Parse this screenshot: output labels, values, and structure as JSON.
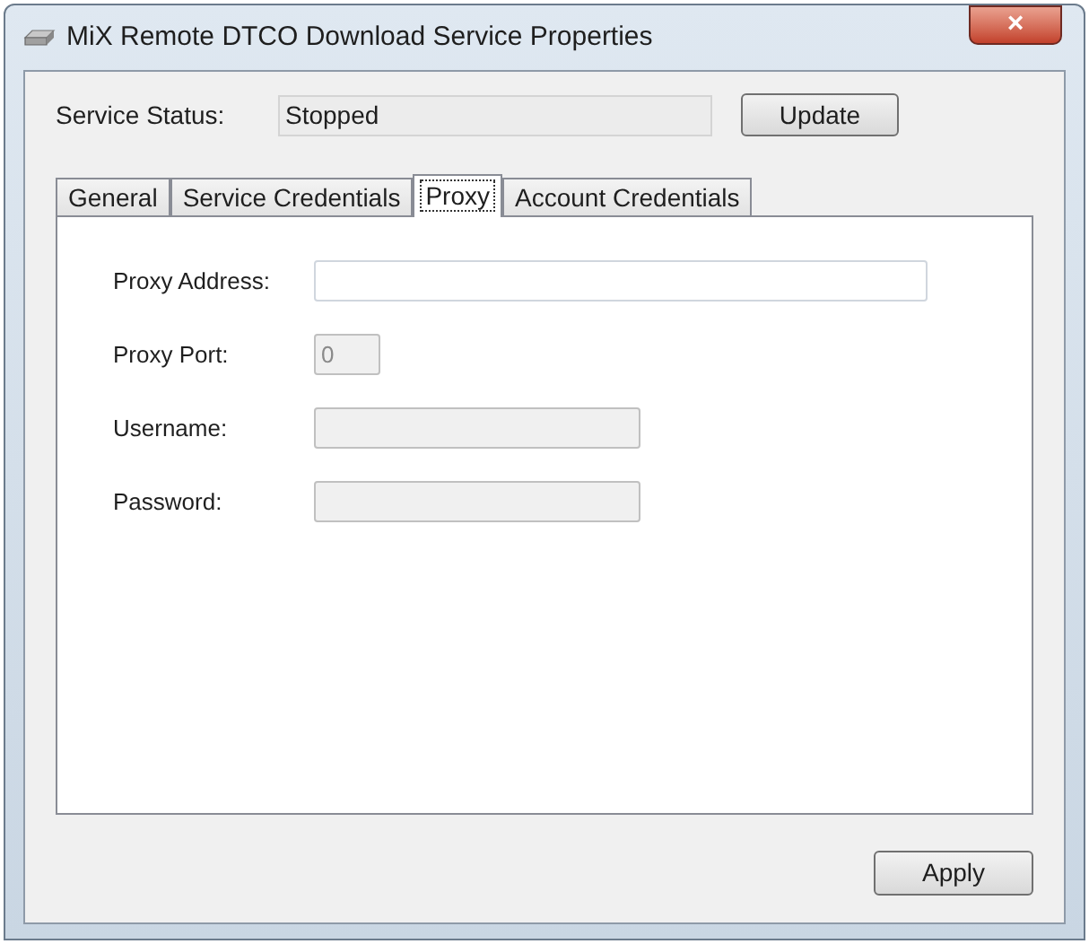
{
  "window": {
    "title": "MiX Remote DTCO Download Service Properties",
    "close_label": "×"
  },
  "service_status": {
    "label": "Service Status:",
    "value": "Stopped",
    "button": "Update"
  },
  "tabs": [
    {
      "label": "General",
      "selected": false
    },
    {
      "label": "Service Credentials",
      "selected": false
    },
    {
      "label": "Proxy",
      "selected": true
    },
    {
      "label": "Account Credentials",
      "selected": false
    }
  ],
  "fields": [
    {
      "label": "Proxy Address:",
      "disabled": false
    },
    {
      "label": "Proxy Port:",
      "value": "0",
      "disabled": true
    },
    {
      "label": "Username:",
      "disabled": true
    },
    {
      "label": "Password:",
      "disabled": true
    }
  ],
  "buttons": [
    "Apply"
  ]
}
